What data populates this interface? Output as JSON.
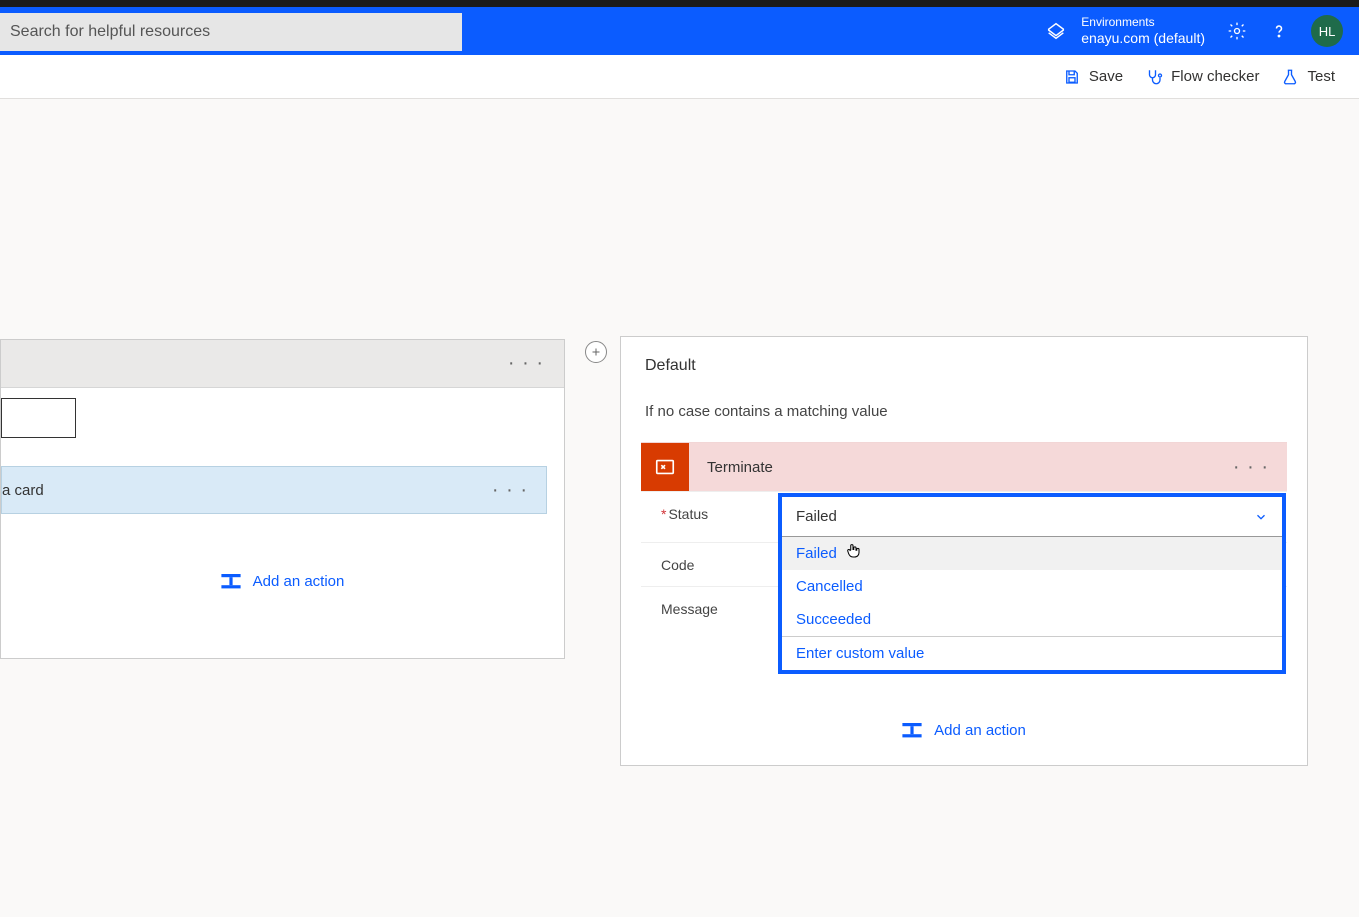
{
  "topbar": {
    "search_placeholder": "Search for helpful resources",
    "env_label": "Environments",
    "env_name": "enayu.com (default)",
    "avatar_initials": "HL"
  },
  "toolbar": {
    "save": "Save",
    "flow_checker": "Flow checker",
    "test": "Test"
  },
  "left_card": {
    "row_text": "a card",
    "add_action": "Add an action"
  },
  "right_card": {
    "title": "Default",
    "subtitle": "If no case contains a matching value",
    "terminate_title": "Terminate",
    "labels": {
      "status": "Status",
      "code": "Code",
      "message": "Message"
    },
    "status_selected": "Failed",
    "status_options": [
      "Failed",
      "Cancelled",
      "Succeeded"
    ],
    "custom_option": "Enter custom value",
    "add_action": "Add an action"
  }
}
